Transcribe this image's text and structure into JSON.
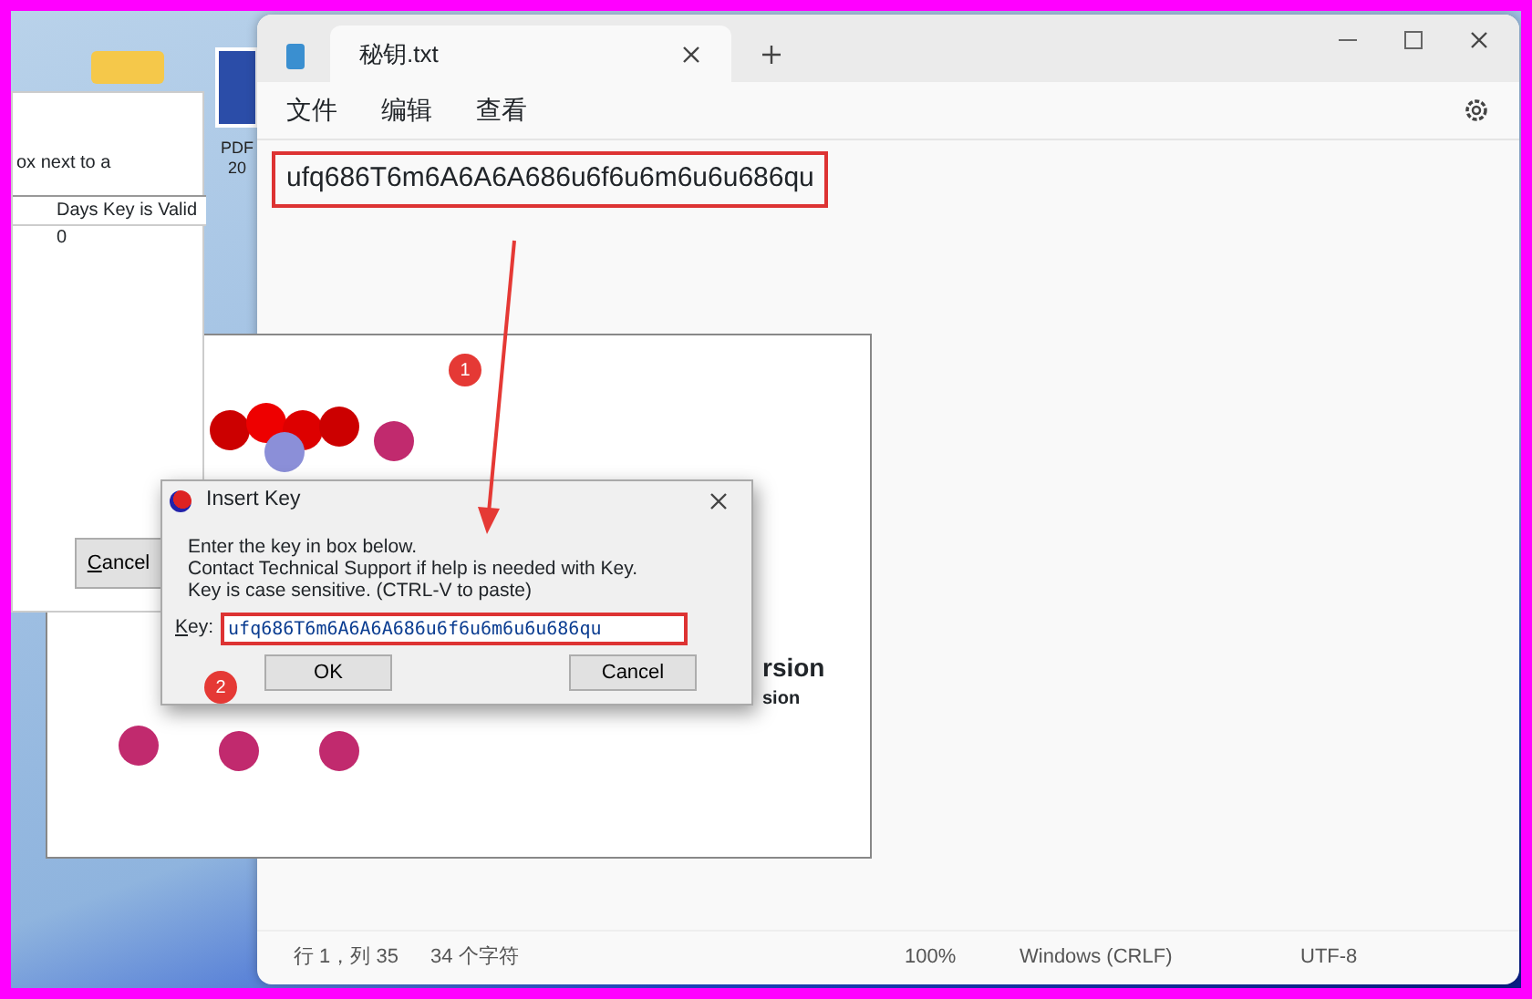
{
  "desktop_icon": {
    "label_lines": [
      "PDF",
      "20"
    ]
  },
  "background_window": {
    "text": "ox next to a",
    "column": "Days Key is Valid",
    "cell": "0",
    "cancel_button": "Cancel"
  },
  "notepad": {
    "tab_title": "秘钥.txt",
    "menu": [
      "文件",
      "编辑",
      "查看"
    ],
    "content": "ufq686T6m6A6A6A686u6f6u6m6u6u686qu",
    "status_bar": [
      "行 1，列 35",
      "34 个字符",
      "100%",
      "Windows (CRLF)",
      "UTF-8"
    ]
  },
  "splash": {
    "texts": [
      "rsion",
      "sion"
    ]
  },
  "dialog": {
    "title": "Insert Key",
    "message": [
      "Enter the key in box below.",
      "Contact Technical Support if help is needed with Key.",
      "Key is case sensitive.  (CTRL-V to paste)"
    ],
    "key_label": "Key:",
    "key_value": "ufq686T6m6A6A6A686u6f6u6m6u6u686qu",
    "buttons": [
      "OK",
      "Cancel"
    ]
  },
  "annotations": [
    {
      "label": "1"
    },
    {
      "label": "2"
    }
  ]
}
